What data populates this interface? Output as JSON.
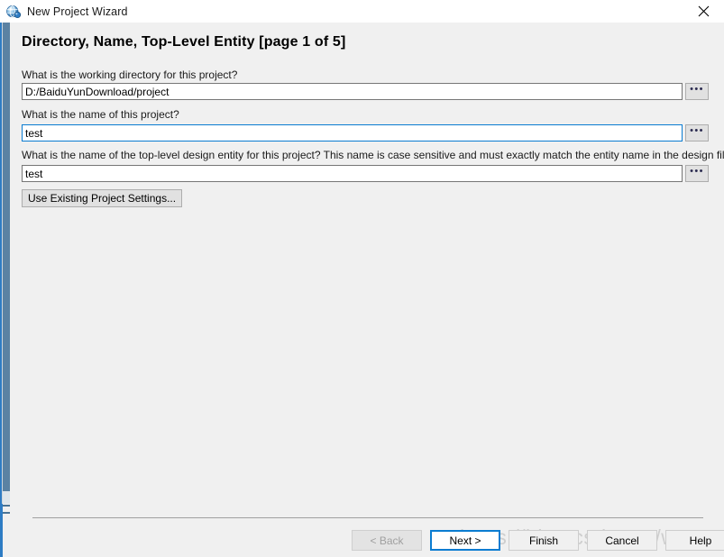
{
  "window": {
    "title": "New Project Wizard",
    "icon": "quartus-globe-icon",
    "close_label": "✕",
    "accent_color": "#0a7cd1",
    "background_color": "#f0f0f0",
    "titlebar_color": "#ffffff"
  },
  "page": {
    "heading": "Directory, Name, Top-Level Entity [page 1 of 5]"
  },
  "form": {
    "fields": [
      {
        "label": "What is the working directory for this project?",
        "value": "D:/BaiduYunDownload/project",
        "browse_label": "•••",
        "focused": false
      },
      {
        "label": "What is the name of this project?",
        "value": "test",
        "browse_label": "•••",
        "focused": true
      },
      {
        "label": "What is the name of the top-level design entity for this project? This name is case sensitive and must exactly match the entity name in the design file.",
        "value": "test",
        "browse_label": "•••",
        "focused": false
      }
    ],
    "existing_settings_button": "Use Existing Project Settings..."
  },
  "footer": {
    "buttons": [
      {
        "label": "< Back",
        "state": "disabled"
      },
      {
        "label": "Next >",
        "state": "default"
      },
      {
        "label": "Finish",
        "state": "normal"
      },
      {
        "label": "Cancel",
        "state": "normal"
      },
      {
        "label": "Help",
        "state": "normal"
      }
    ]
  },
  "watermark": {
    "text": "https://blog.csdn.net/wy6602"
  }
}
